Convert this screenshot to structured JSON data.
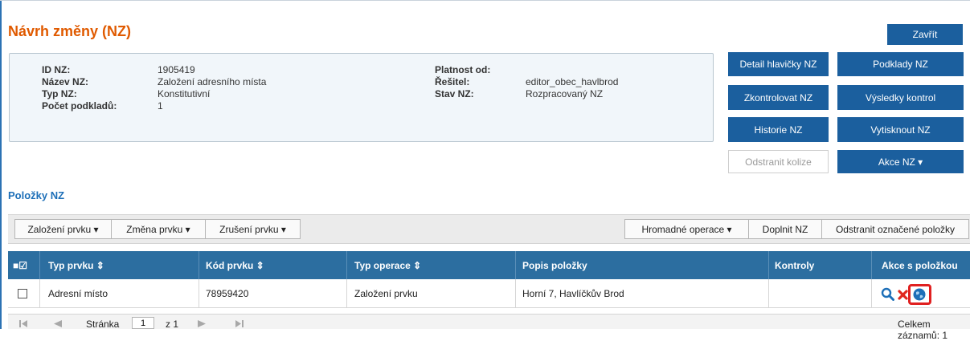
{
  "header": {
    "title": "Návrh změny (NZ)",
    "close_label": "Zavřít"
  },
  "info": {
    "id_label": "ID NZ:",
    "id_value": "1905419",
    "name_label": "Název NZ:",
    "name_value": "Založení adresního místa",
    "type_label": "Typ NZ:",
    "type_value": "Konstitutivní",
    "count_label": "Počet podkladů:",
    "count_value": "1",
    "valid_label": "Platnost od:",
    "valid_value": "",
    "solver_label": "Řešitel:",
    "solver_value": "editor_obec_havlbrod",
    "state_label": "Stav NZ:",
    "state_value": "Rozpracovaný NZ"
  },
  "actions": {
    "detail": "Detail hlavičky NZ",
    "sources": "Podklady NZ",
    "check": "Zkontrolovat NZ",
    "results": "Výsledky kontrol",
    "history": "Historie NZ",
    "print": "Vytisknout NZ",
    "remove_collisions": "Odstranit kolize",
    "action_menu": "Akce NZ ▾"
  },
  "section": {
    "title": "Položky NZ"
  },
  "toolbar": {
    "create": "Založení prvku ▾",
    "change": "Změna prvku ▾",
    "cancel": "Zrušení prvku ▾",
    "bulk": "Hromadné operace ▾",
    "fill": "Doplnit NZ",
    "remove_selected": "Odstranit označené položky"
  },
  "table": {
    "columns": [
      "Typ prvku ⇕",
      "Kód prvku ⇕",
      "Typ operace ⇕",
      "Popis položky",
      "Kontroly",
      "Akce s položkou"
    ],
    "select_all_icon": "■☑",
    "rows": [
      {
        "type": "Adresní místo",
        "code": "78959420",
        "operation": "Založení prvku",
        "description": "Horní 7, Havlíčkův Brod",
        "checks": ""
      }
    ]
  },
  "pager": {
    "page_label": "Stránka",
    "page_value": "1",
    "of_label": "z 1",
    "total_label": "Celkem záznamů: 1"
  },
  "colors": {
    "accent": "#e05a00",
    "primary": "#1b5f9e",
    "header": "#2c6ea0",
    "highlight": "#e02020"
  }
}
